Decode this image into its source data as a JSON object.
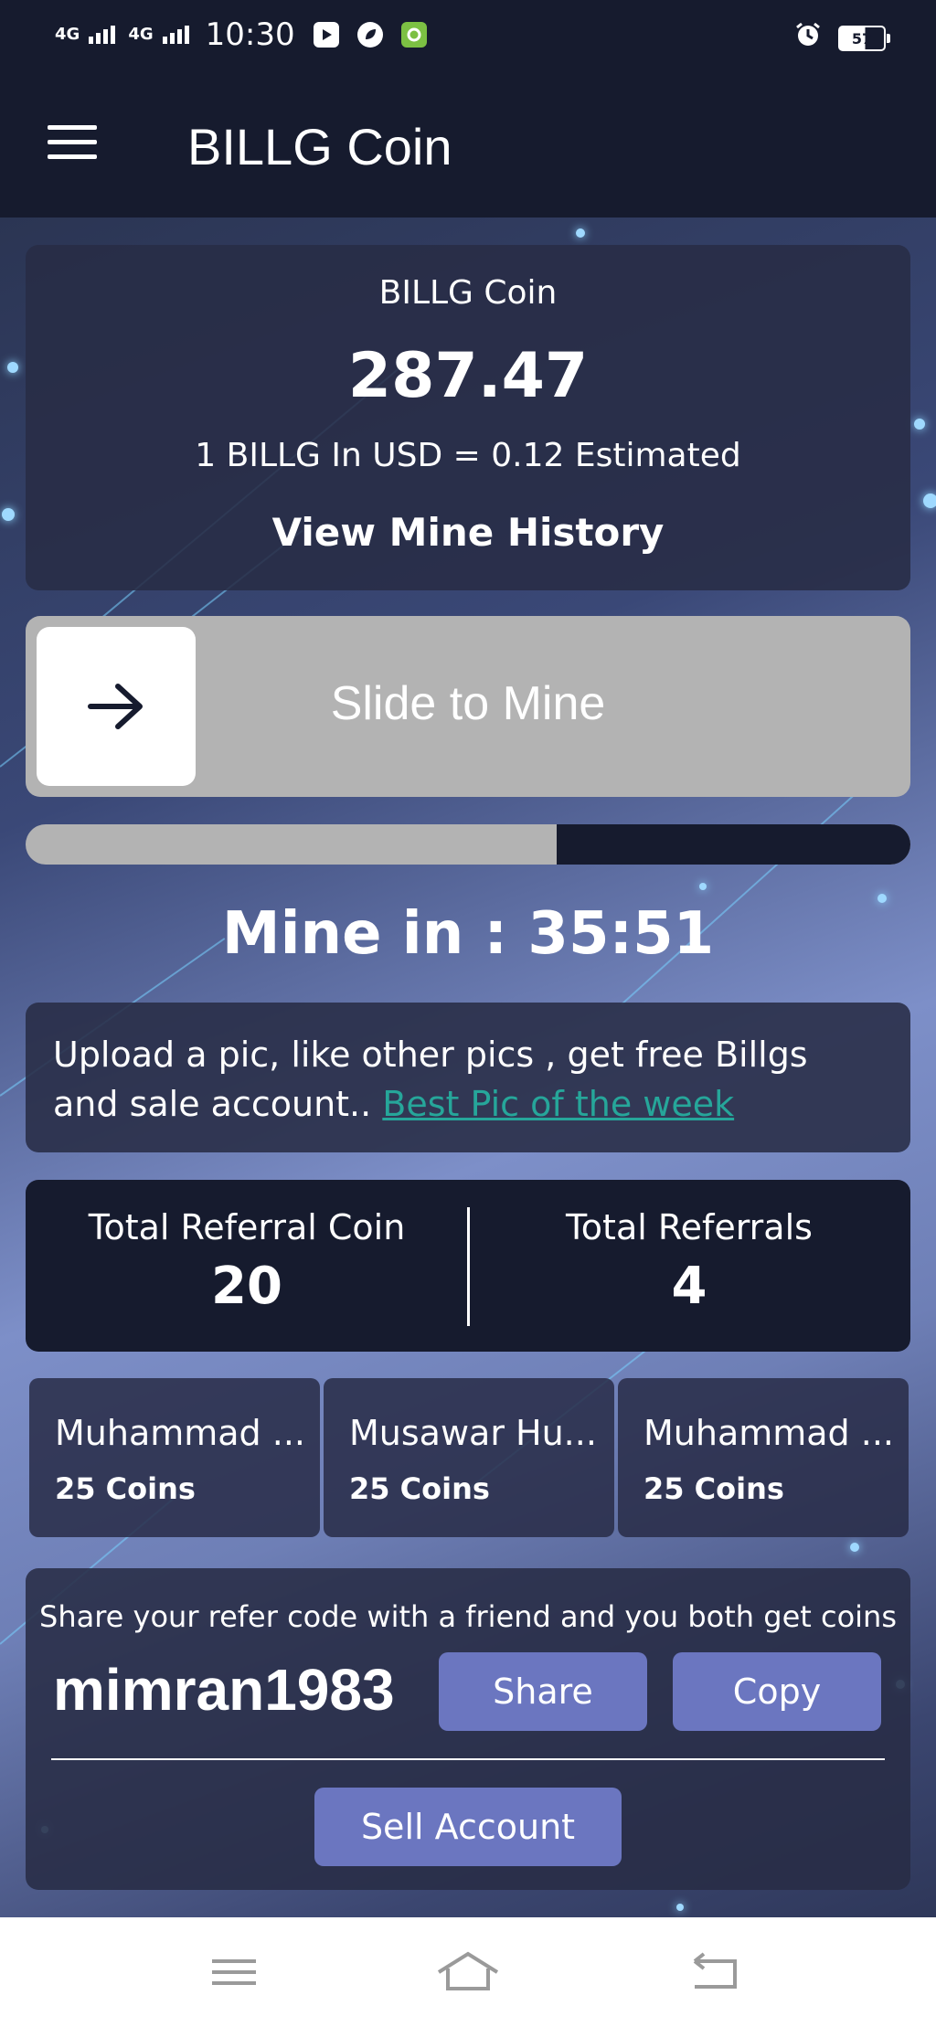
{
  "status_bar": {
    "network_1": "4G",
    "network_2": "4G",
    "time": "10:30",
    "battery": "57"
  },
  "app_bar": {
    "title": "BILLG Coin"
  },
  "balance": {
    "label": "BILLG Coin",
    "amount": "287.47",
    "rate": "1 BILLG In USD = 0.12 Estimated",
    "history_link": "View Mine History"
  },
  "slider": {
    "label": "Slide to Mine"
  },
  "mining": {
    "progress_fraction": 0.6,
    "timer": "Mine in : 35:51"
  },
  "promo": {
    "text": "Upload a pic, like other pics , get free Billgs and sale account.. ",
    "link": "Best Pic of the week "
  },
  "referrals": {
    "coin_label": "Total Referral Coin",
    "coin_value": "20",
    "count_label": "Total Referrals",
    "count_value": "4"
  },
  "referral_list": [
    {
      "name": "Muhammad ...",
      "coins": "25 Coins"
    },
    {
      "name": "Musawar Hu...",
      "coins": "25 Coins"
    },
    {
      "name": "Muhammad ...",
      "coins": "25 Coins"
    }
  ],
  "share": {
    "note": "Share your refer code with a friend and you both get coins",
    "code": "mimran1983",
    "share_label": "Share",
    "copy_label": "Copy",
    "sell_label": "Sell Account"
  },
  "colors": {
    "dark": "#161b2e",
    "button": "#6b76c0",
    "link": "#26a69a",
    "slider": "#b3b3b3"
  }
}
